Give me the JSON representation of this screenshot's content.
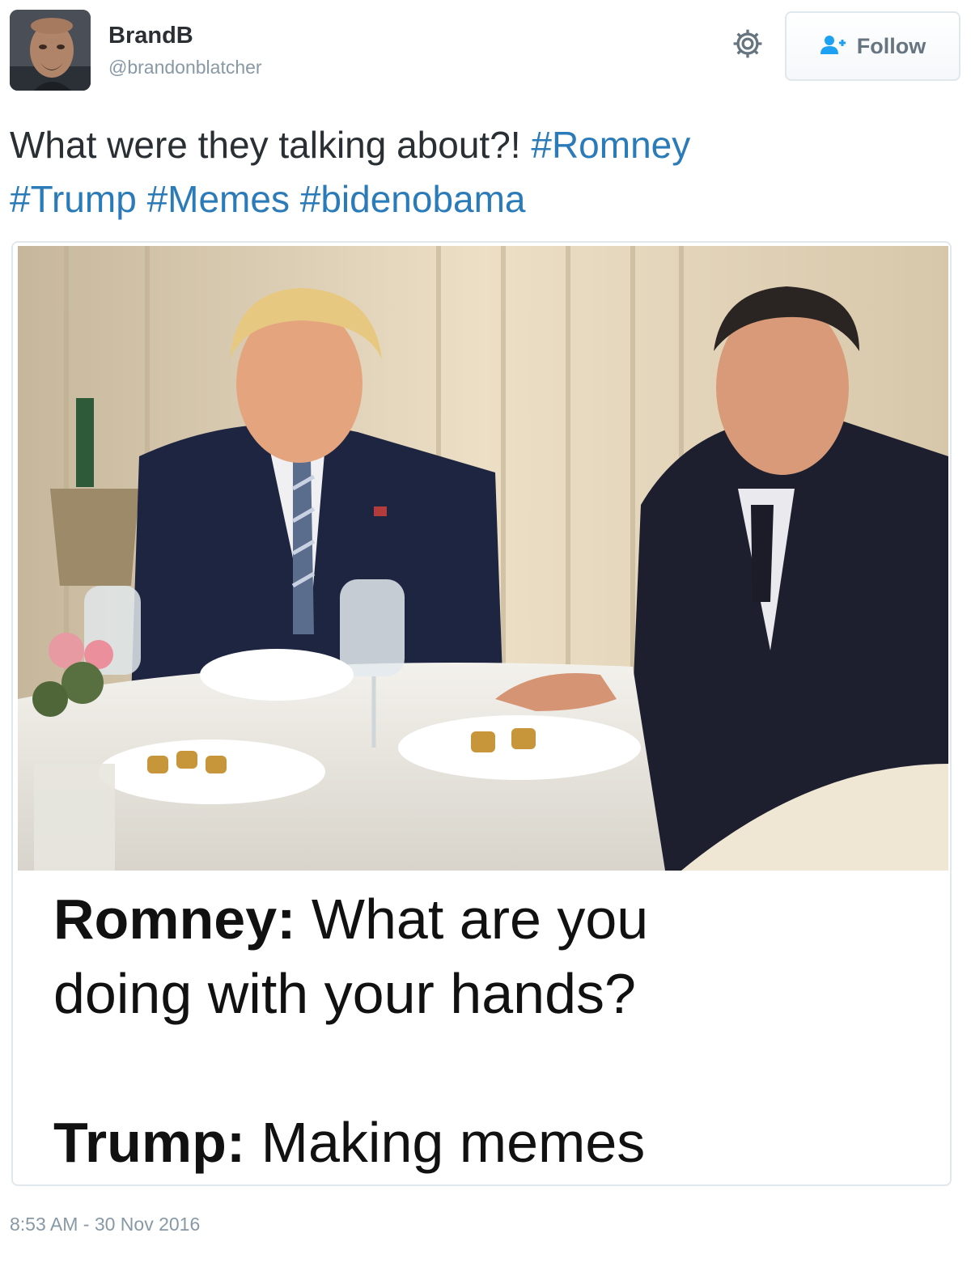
{
  "author": {
    "display_name": "BrandB",
    "handle": "@brandonblatcher",
    "avatar_icon": "user-avatar-photo"
  },
  "actions": {
    "settings_icon": "gear-icon",
    "follow_icon": "add-user-icon",
    "follow_label": "Follow"
  },
  "tweet": {
    "text": "What were they talking about?! ",
    "hashtags": [
      "#Romney",
      "#Trump",
      "#Memes",
      "#bidenobama"
    ],
    "timestamp": "8:53 AM - 30 Nov 2016"
  },
  "media": {
    "caption_line1_speaker": "Romney:",
    "caption_line1_text": " What are you",
    "caption_line2_text": "doing with your hands?",
    "caption_line3_speaker": "Trump:",
    "caption_line3_text": " Making memes"
  },
  "colors": {
    "link": "#2b7bb9",
    "muted": "#8899a6",
    "border": "#e1e8ed",
    "text": "#292f33"
  }
}
